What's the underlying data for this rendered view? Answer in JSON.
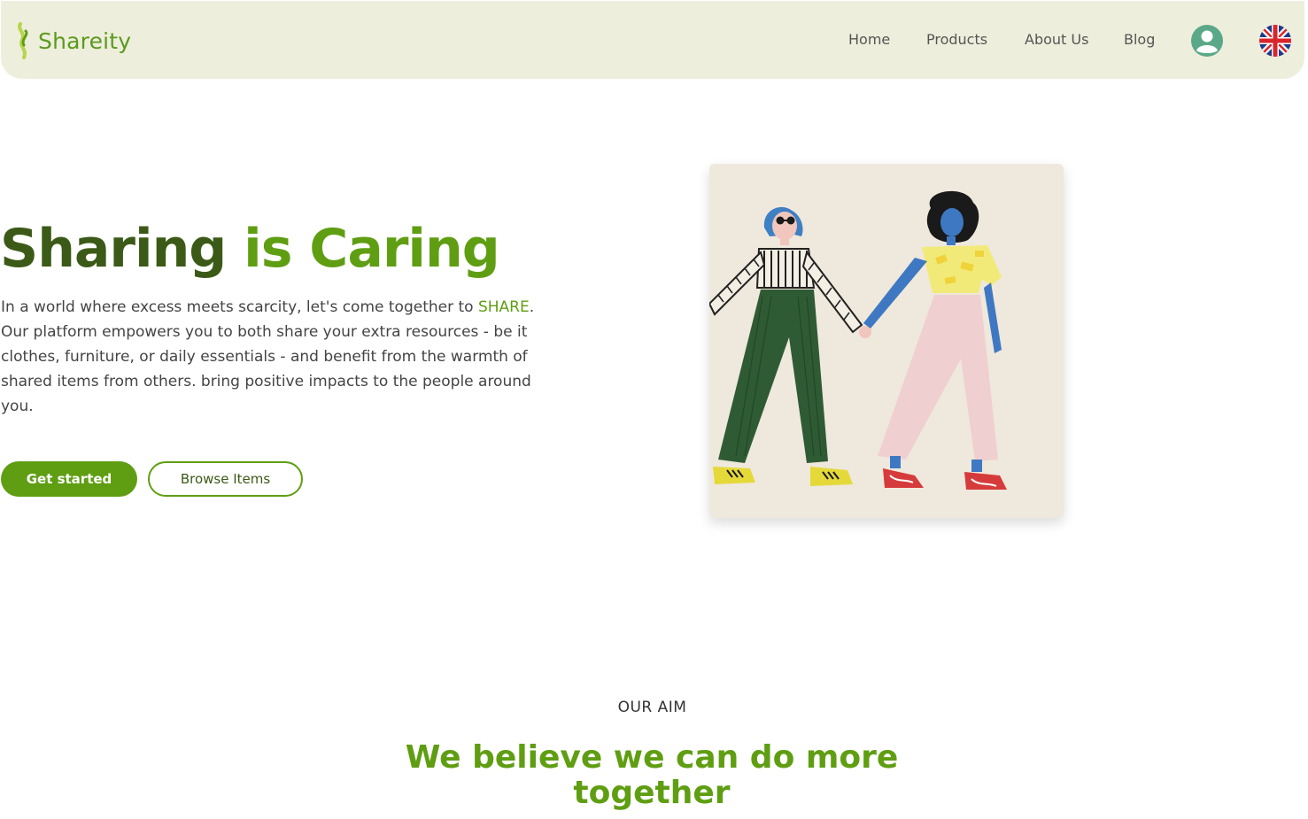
{
  "header": {
    "brand": "Shareity",
    "nav": [
      {
        "label": "Home"
      },
      {
        "label": "Products"
      },
      {
        "label": "About Us"
      },
      {
        "label": "Blog"
      }
    ],
    "icons": {
      "logo": "leaf-chain-logo",
      "user": "user-avatar-icon",
      "language": "uk-flag-icon"
    }
  },
  "hero": {
    "title_part1": "Sharing",
    "title_part2": "is Caring",
    "desc_before": "In a world where excess meets scarcity, let's come together to ",
    "desc_highlight": "SHARE",
    "desc_after": ". Our platform empowers you to both share your extra resources - be it clothes, furniture, or daily essentials - and benefit from the warmth of shared items from others. bring positive impacts to the people around you.",
    "primary_button": "Get started",
    "secondary_button": "Browse Items"
  },
  "aim": {
    "label": "OUR AIM",
    "heading": "We believe we can do more together"
  },
  "colors": {
    "brand_green": "#5f9e12",
    "dark_green": "#3b5a17",
    "header_bg": "#eeeedc",
    "avatar_bg": "#5ba889",
    "illustration_bg": "#efe8dc"
  }
}
